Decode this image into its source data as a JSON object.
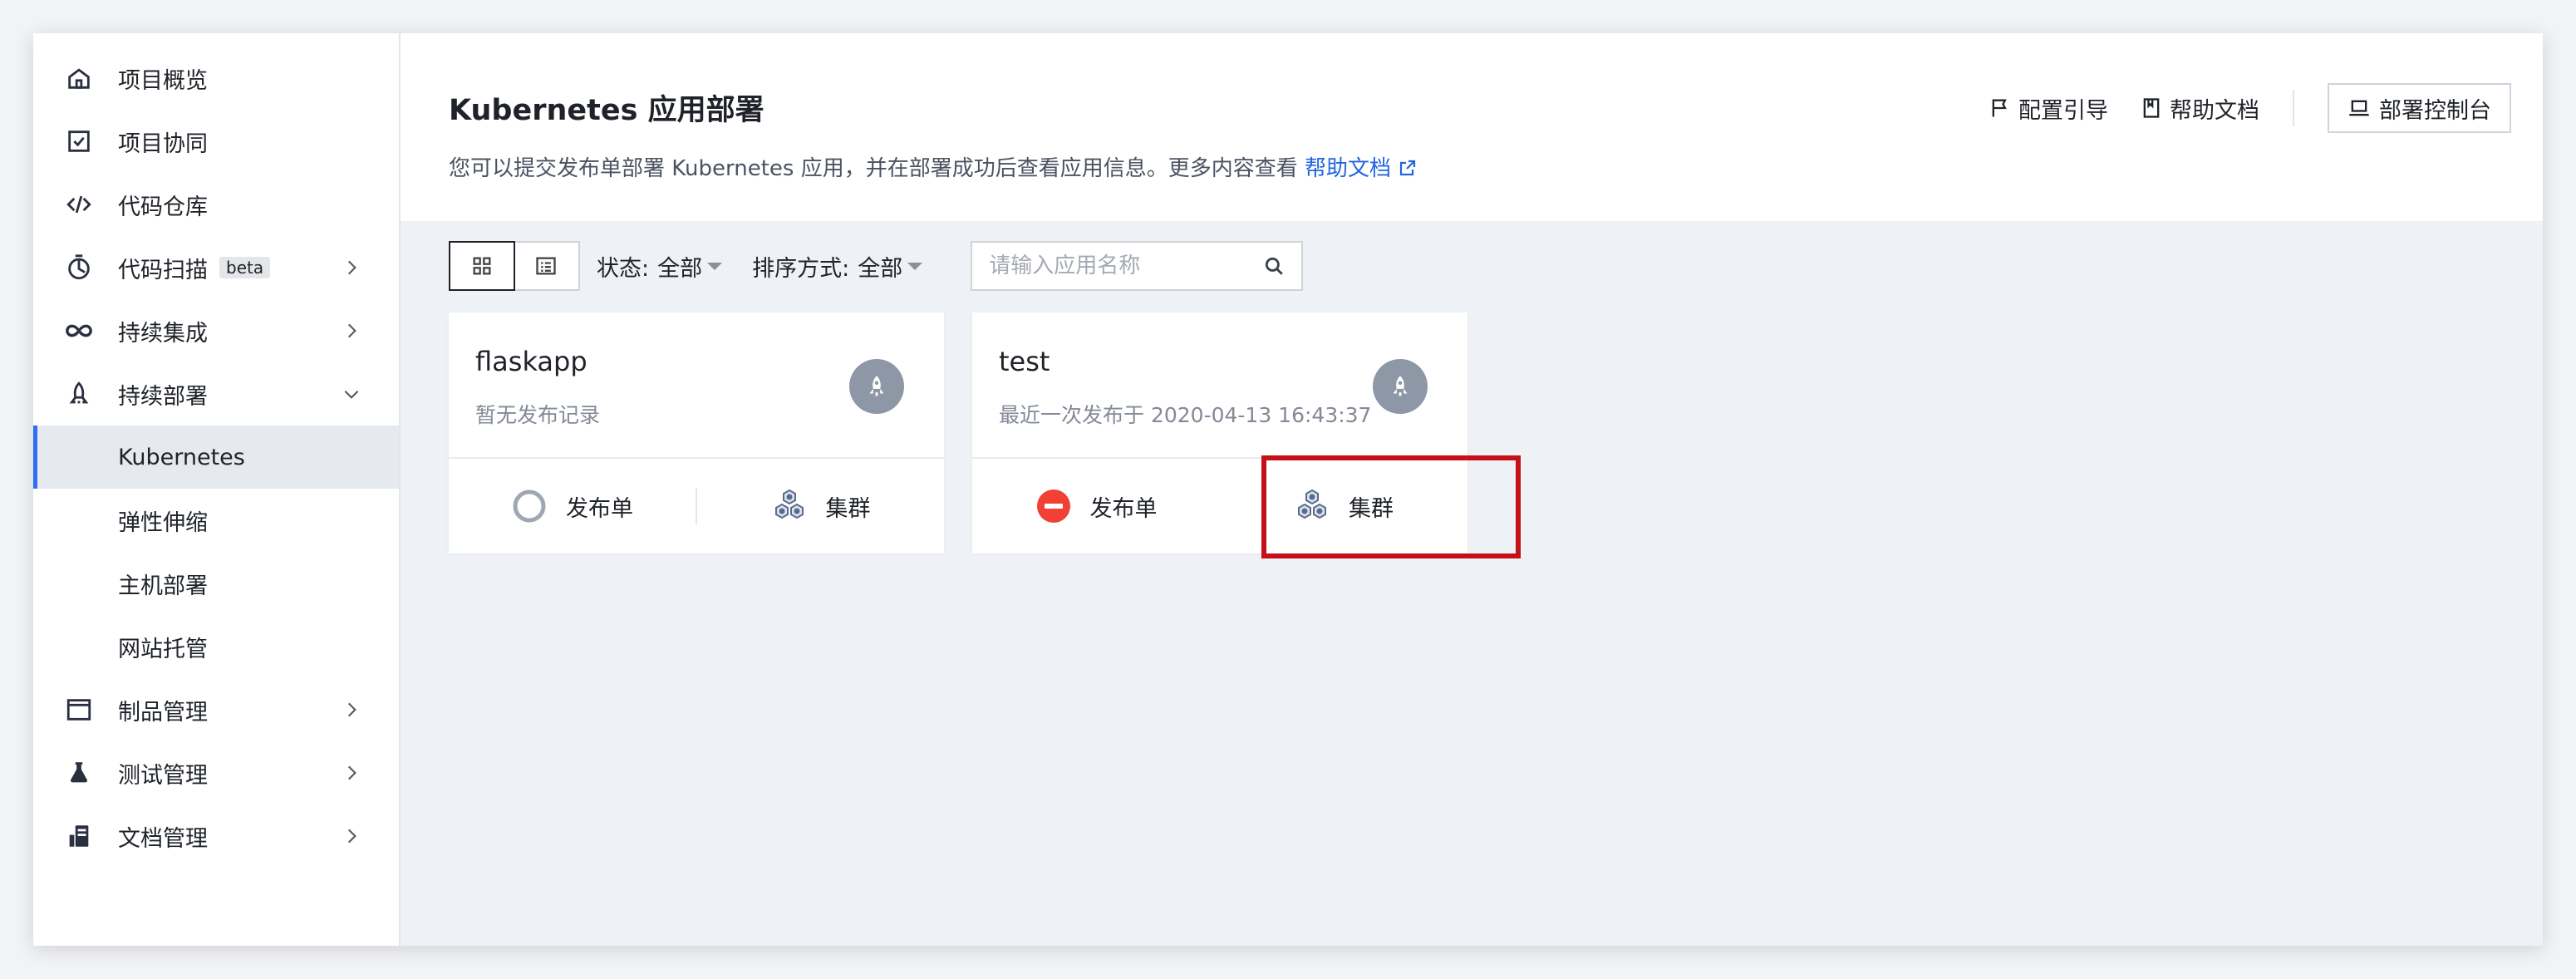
{
  "sidebar": {
    "items": [
      {
        "label": "项目概览",
        "icon": "home-icon"
      },
      {
        "label": "项目协同",
        "icon": "checkbox-icon"
      },
      {
        "label": "代码仓库",
        "icon": "code-icon"
      },
      {
        "label": "代码扫描",
        "icon": "scan-icon",
        "badge": "beta"
      },
      {
        "label": "持续集成",
        "icon": "infinity-icon"
      },
      {
        "label": "持续部署",
        "icon": "rocket-icon"
      },
      {
        "label": "Kubernetes"
      },
      {
        "label": "弹性伸缩"
      },
      {
        "label": "主机部署"
      },
      {
        "label": "网站托管"
      },
      {
        "label": "制品管理",
        "icon": "package-icon"
      },
      {
        "label": "测试管理",
        "icon": "flask-icon"
      },
      {
        "label": "文档管理",
        "icon": "document-icon"
      }
    ],
    "active": "Kubernetes"
  },
  "header": {
    "title": "Kubernetes 应用部署",
    "description": "您可以提交发布单部署 Kubernetes 应用，并在部署成功后查看应用信息。更多内容查看",
    "help_link": "帮助文档",
    "actions": {
      "guide": "配置引导",
      "docs": "帮助文档",
      "console": "部署控制台"
    }
  },
  "toolbar": {
    "status_label": "状态:",
    "status_value": "全部",
    "sort_label": "排序方式:",
    "sort_value": "全部",
    "search_placeholder": "请输入应用名称"
  },
  "apps": [
    {
      "name": "flaskapp",
      "subtitle": "暂无发布记录",
      "release_label": "发布单",
      "release_status": "none",
      "cluster_label": "集群"
    },
    {
      "name": "test",
      "subtitle": "最近一次发布于 2020-04-13 16:43:37",
      "release_label": "发布单",
      "release_status": "failed",
      "cluster_label": "集群"
    }
  ],
  "colors": {
    "accent": "#2f6cf3",
    "link": "#2265de",
    "failed": "#f04134",
    "highlight": "#c5101a"
  }
}
